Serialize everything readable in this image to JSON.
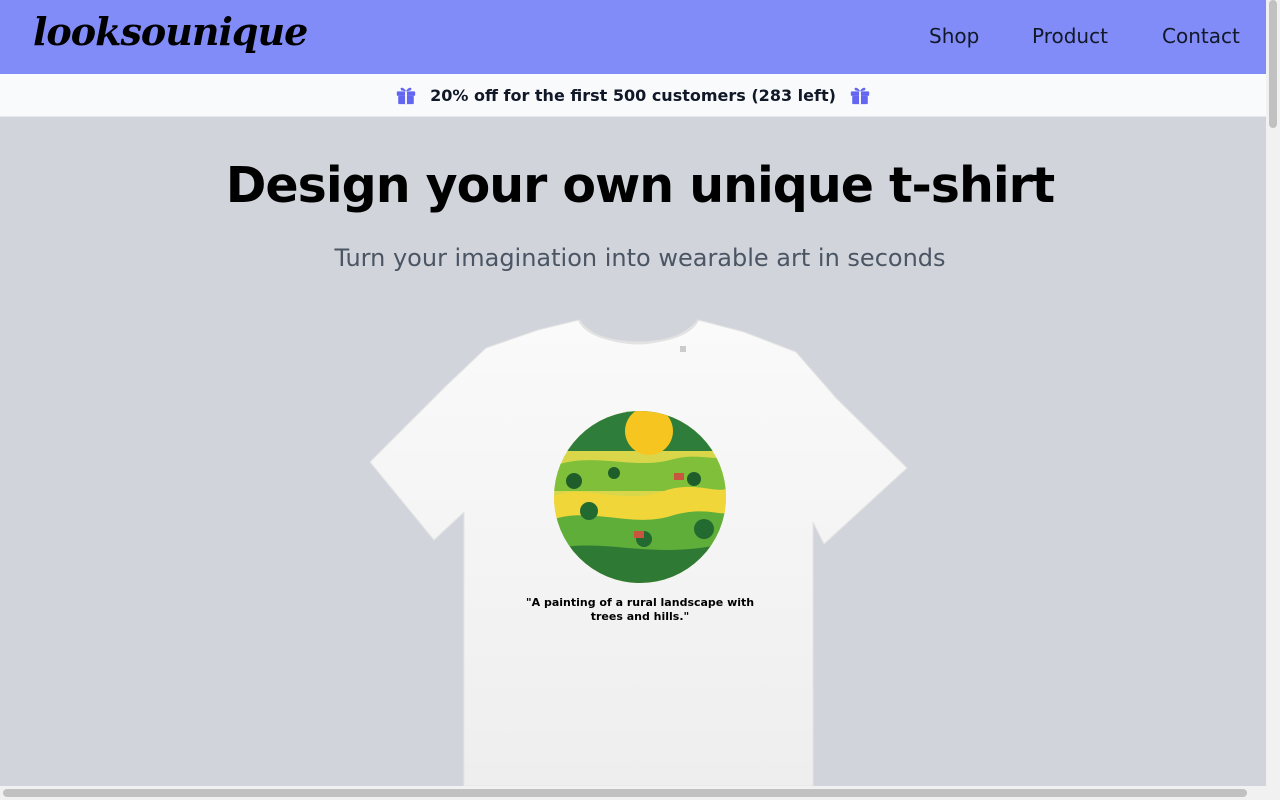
{
  "brand": {
    "name": "looksounique"
  },
  "nav": {
    "items": [
      {
        "label": "Shop"
      },
      {
        "label": "Product"
      },
      {
        "label": "Contact"
      }
    ]
  },
  "promo": {
    "text": "20% off for the first 500 customers (283 left)",
    "icon": "gift-icon"
  },
  "hero": {
    "title": "Design your own unique t-shirt",
    "subtitle": "Turn your imagination into wearable art in seconds"
  },
  "product": {
    "caption_line1": "\"A painting of a rural landscape with",
    "caption_line2": "trees and hills.\""
  },
  "colors": {
    "navbar": "#818cf8",
    "accent": "#6366f1",
    "background": "#d1d5db"
  }
}
